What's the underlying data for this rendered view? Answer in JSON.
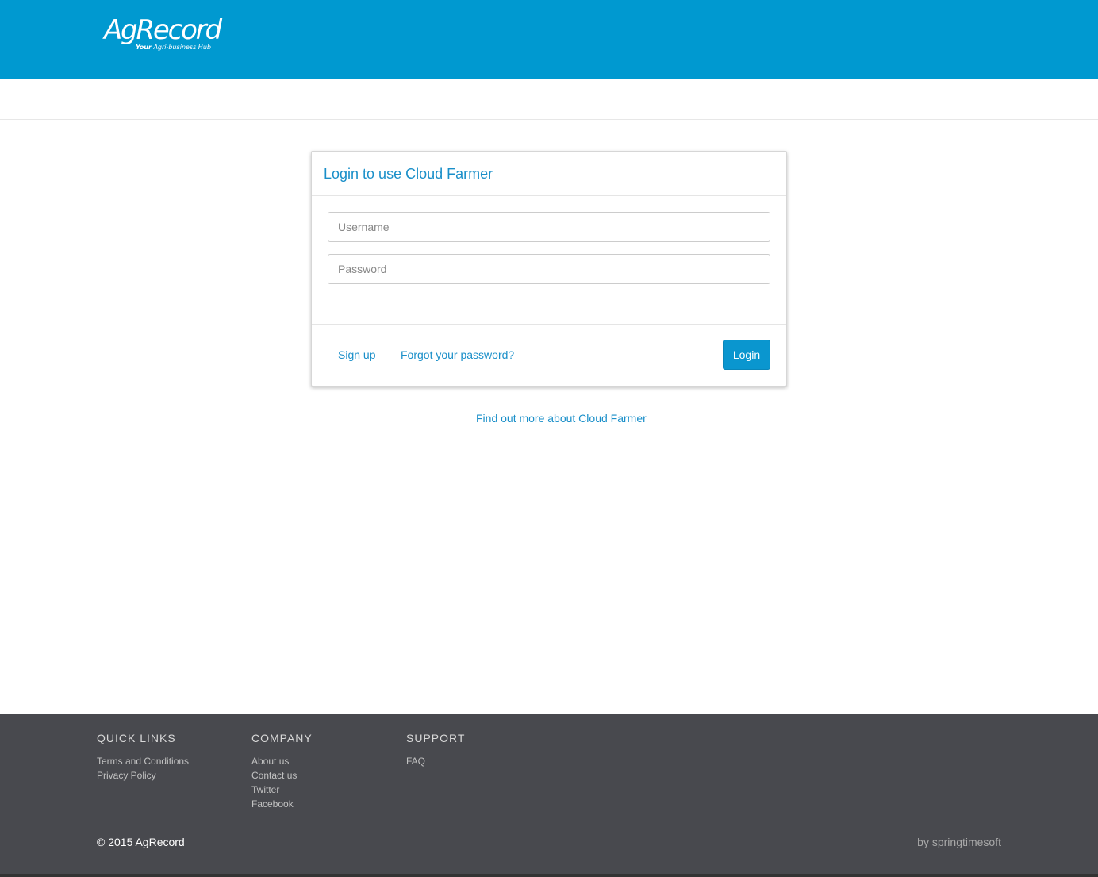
{
  "header": {
    "logo_main": "AgRecord",
    "logo_sub_bold": "Your",
    "logo_sub_rest": " Agri-business Hub",
    "background": "#0099d0"
  },
  "login_panel": {
    "title": "Login to use Cloud Farmer",
    "username_placeholder": "Username",
    "password_placeholder": "Password",
    "signup_label": "Sign up",
    "forgot_label": "Forgot your password?",
    "login_label": "Login"
  },
  "more_link": "Find out more about Cloud Farmer",
  "footer": {
    "columns": [
      {
        "heading": "QUICK LINKS",
        "links": [
          "Terms and Conditions",
          "Privacy Policy"
        ]
      },
      {
        "heading": "COMPANY",
        "links": [
          "About us",
          "Contact us",
          "Twitter",
          "Facebook"
        ]
      },
      {
        "heading": "SUPPORT",
        "links": [
          "FAQ"
        ]
      }
    ],
    "copyright": "© 2015 AgRecord",
    "byline": "by springtimesoft",
    "background": "#48494e"
  },
  "colors": {
    "accent": "#1a8fc9",
    "button": "#0a96cf"
  }
}
